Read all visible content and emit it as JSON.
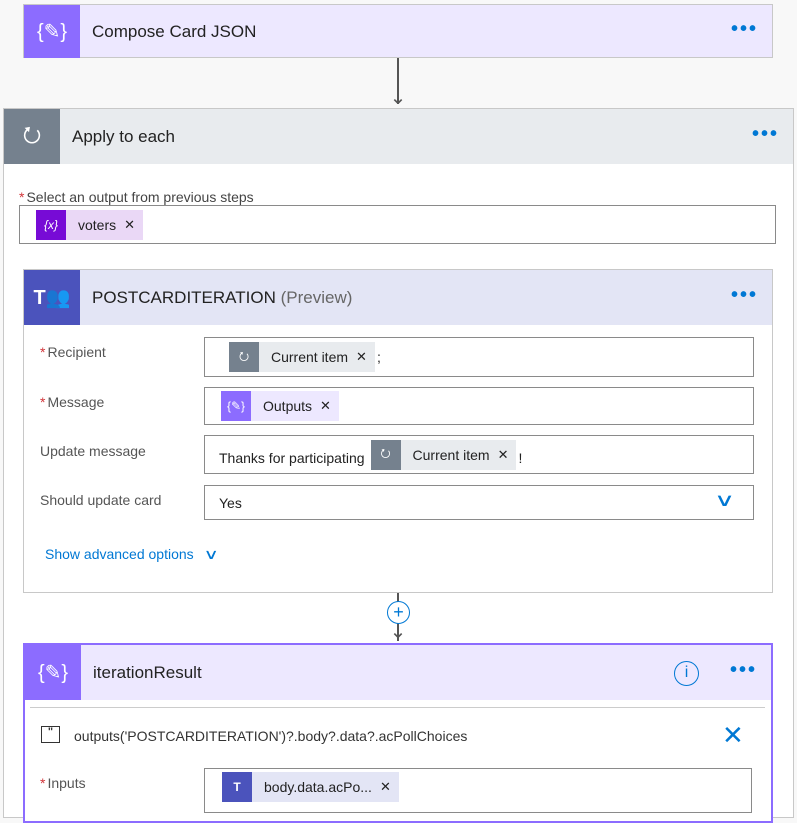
{
  "compose": {
    "title": "Compose Card JSON",
    "more": "•••",
    "icon": "compose-braces-icon"
  },
  "apply": {
    "title": "Apply to each",
    "more": "•••",
    "icon": "loop-icon",
    "select_label": "Select an output from previous steps",
    "token": "voters",
    "token_icon": "variable-icon"
  },
  "post": {
    "title": "POSTCARDITERATION",
    "preview": "(Preview)",
    "more": "•••",
    "icon": "teams-icon",
    "fields": [
      {
        "label": "Recipient",
        "required": true,
        "token": "Current item",
        "suffix": ";"
      },
      {
        "label": "Message",
        "required": true,
        "token": "Outputs"
      },
      {
        "label": "Update message",
        "required": false,
        "text": "Thanks for participating",
        "token": "Current item",
        "suffix": "!"
      },
      {
        "label": "Should update card",
        "required": false,
        "value": "Yes"
      }
    ],
    "advanced": "Show advanced options"
  },
  "iter": {
    "title": "iterationResult",
    "more": "•••",
    "info": "i",
    "expression": "outputs('POSTCARDITERATION')?.body?.data?.acPollChoices",
    "inputs_label": "Inputs",
    "token": "body.data.acPo..."
  },
  "colors": {
    "accent": "#0078d4",
    "compose": "#8c6cff",
    "compose_bg": "#ede8ff",
    "loop": "#75818e",
    "loop_bg": "#e8ebee",
    "teams": "#4b53bc",
    "teams_bg": "#e3e5f5",
    "variable": "#770bd6",
    "variable_bg": "#ead8f6",
    "required": "#d13438"
  }
}
